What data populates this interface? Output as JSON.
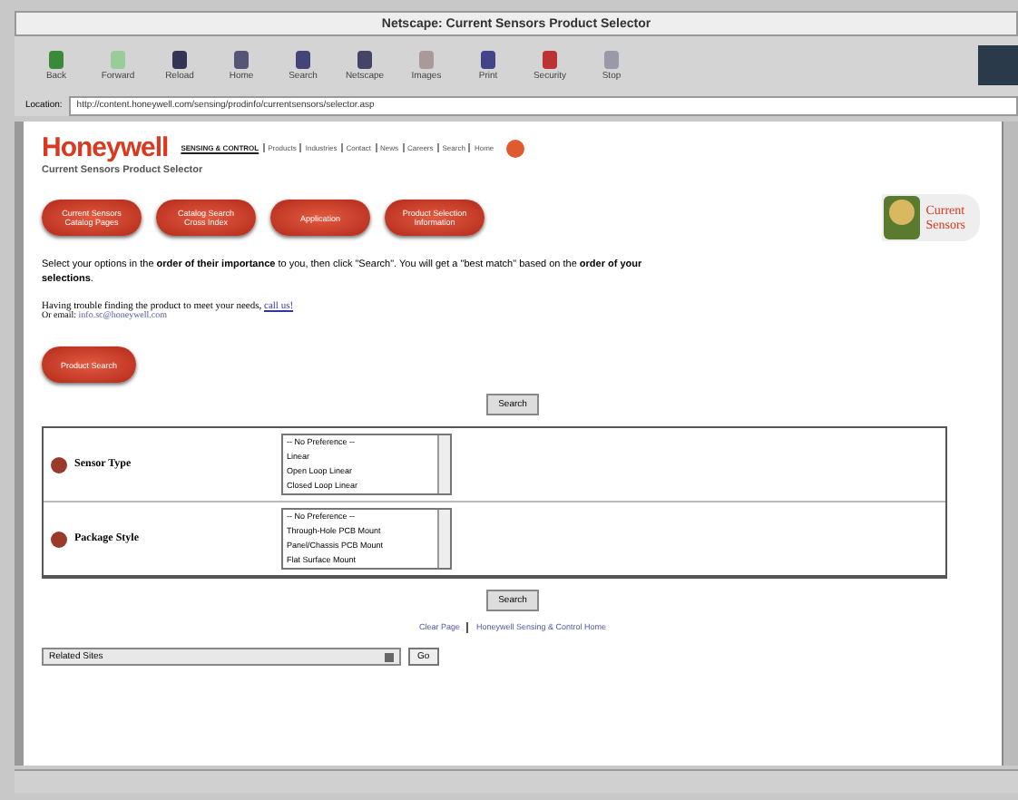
{
  "window": {
    "title": "Netscape: Current Sensors Product Selector"
  },
  "toolbar": [
    {
      "label": "Back",
      "kind": "back"
    },
    {
      "label": "Forward",
      "kind": "forward"
    },
    {
      "label": "Reload",
      "kind": "reload"
    },
    {
      "label": "Home",
      "kind": "home"
    },
    {
      "label": "Search",
      "kind": "search"
    },
    {
      "label": "Netscape",
      "kind": "netscape"
    },
    {
      "label": "Images",
      "kind": "images"
    },
    {
      "label": "Print",
      "kind": "print"
    },
    {
      "label": "Security",
      "kind": "security"
    },
    {
      "label": "Stop",
      "kind": "stop"
    }
  ],
  "location": {
    "label": "Location:",
    "value": "http://content.honeywell.com/sensing/prodinfo/currentsensors/selector.asp"
  },
  "header": {
    "logo": "Honeywell",
    "nav": [
      "SENSING & CONTROL",
      "Products",
      "Industries",
      "Contact",
      "News",
      "Careers",
      "Search",
      "Home"
    ],
    "subtitle": "Current Sensors Product Selector"
  },
  "pill_buttons": [
    "Current Sensors Catalog Pages",
    "Catalog Search Cross Index",
    "Application",
    "Product Selection Information"
  ],
  "badge": {
    "line1": "Current",
    "line2": "Sensors"
  },
  "intro": "Select your options in the **order of their importance** to you, then click \"Search\". You will get a \"best match\" based on the **order of your selections**.",
  "help": {
    "text": "Having trouble finding the product to meet your needs,",
    "link": "call us!",
    "email_label": "Or email:",
    "email": "info.sc@honeywell.com"
  },
  "side_pill": "Product Search",
  "search_button": "Search",
  "criteria": [
    {
      "label": "Sensor Type",
      "options": [
        "-- No Preference --",
        "Linear",
        "Open Loop Linear",
        "Closed Loop Linear"
      ]
    },
    {
      "label": "Package Style",
      "options": [
        "-- No Preference --",
        "Through-Hole PCB Mount",
        "Panel/Chassis PCB Mount",
        "Flat Surface Mount"
      ]
    }
  ],
  "search_button_2": "Search",
  "footer_links": [
    "Clear Page",
    "Honeywell Sensing & Control Home"
  ],
  "related": {
    "value": "Related Sites",
    "go": "Go"
  }
}
